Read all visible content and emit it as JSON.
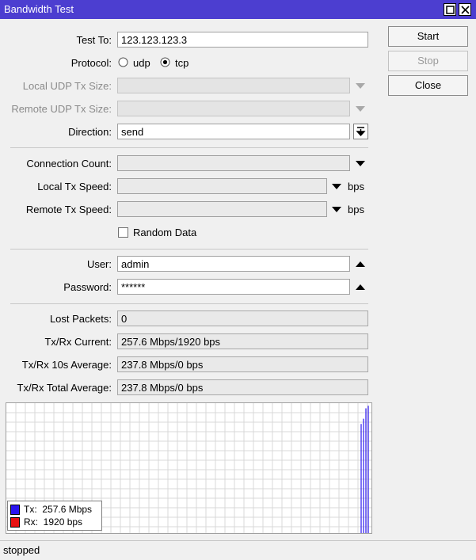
{
  "window": {
    "title": "Bandwidth Test",
    "controls": [
      "restore-icon",
      "close-icon"
    ]
  },
  "form": {
    "test_to": {
      "label": "Test To:",
      "value": "123.123.123.3"
    },
    "protocol": {
      "label": "Protocol:",
      "options": [
        "udp",
        "tcp"
      ],
      "selected": "tcp"
    },
    "local_udp_tx_size": {
      "label": "Local UDP Tx Size:",
      "value": ""
    },
    "remote_udp_tx_size": {
      "label": "Remote UDP Tx Size:",
      "value": ""
    },
    "direction": {
      "label": "Direction:",
      "value": "send"
    },
    "connection_count": {
      "label": "Connection Count:",
      "value": ""
    },
    "local_tx_speed": {
      "label": "Local Tx Speed:",
      "value": "",
      "unit": "bps"
    },
    "remote_tx_speed": {
      "label": "Remote Tx Speed:",
      "value": "",
      "unit": "bps"
    },
    "random_data": {
      "label": "Random Data",
      "checked": false
    },
    "user": {
      "label": "User:",
      "value": "admin"
    },
    "password": {
      "label": "Password:",
      "value": "******"
    },
    "lost_packets": {
      "label": "Lost Packets:",
      "value": "0"
    },
    "txrx_current": {
      "label": "Tx/Rx Current:",
      "value": "257.6 Mbps/1920 bps"
    },
    "txrx_10s_avg": {
      "label": "Tx/Rx 10s Average:",
      "value": "237.8 Mbps/0 bps"
    },
    "txrx_total_avg": {
      "label": "Tx/Rx Total Average:",
      "value": "237.8 Mbps/0 bps"
    }
  },
  "buttons": {
    "start": "Start",
    "stop": "Stop",
    "close": "Close"
  },
  "graph": {
    "legend": [
      {
        "name": "Tx:",
        "value": "257.6 Mbps",
        "color": "#2a14f0"
      },
      {
        "name": "Rx:",
        "value": "1920 bps",
        "color": "#e81010"
      }
    ],
    "tx_bars": [
      0.84,
      0.88,
      0.96,
      0.98
    ]
  },
  "status": "stopped"
}
